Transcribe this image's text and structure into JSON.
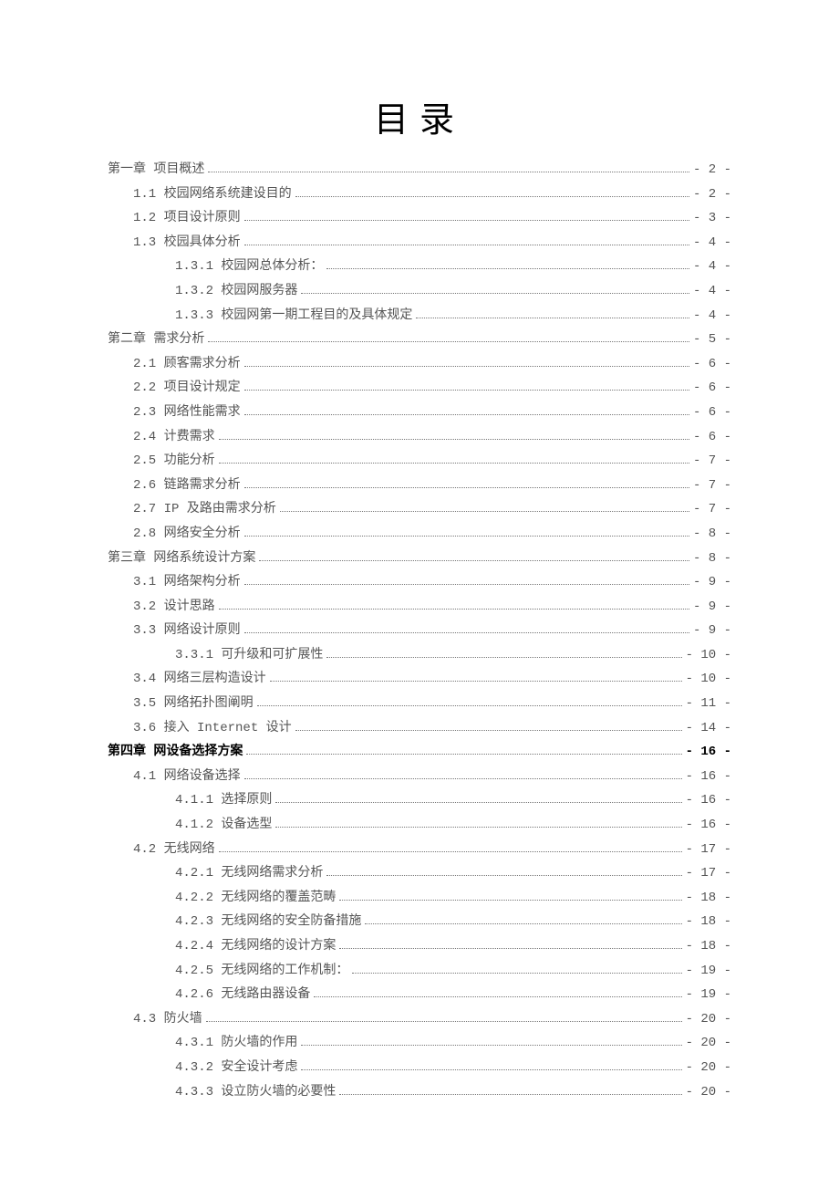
{
  "title": "目录",
  "toc": [
    {
      "level": 0,
      "text": "第一章 项目概述",
      "page": "- 2 -"
    },
    {
      "level": 1,
      "text": "1.1 校园网络系统建设目的",
      "page": "- 2 -"
    },
    {
      "level": 1,
      "text": "1.2 项目设计原则",
      "page": "- 3 -"
    },
    {
      "level": 1,
      "text": "1.3 校园具体分析",
      "page": "- 4 -"
    },
    {
      "level": 2,
      "text": "1.3.1 校园网总体分析：",
      "page": "- 4 -"
    },
    {
      "level": 2,
      "text": "1.3.2 校园网服务器",
      "page": "- 4 -"
    },
    {
      "level": 2,
      "text": "1.3.3 校园网第一期工程目的及具体规定",
      "page": "- 4 -"
    },
    {
      "level": 0,
      "text": "第二章 需求分析",
      "page": "- 5 -"
    },
    {
      "level": 1,
      "text": "2.1 顾客需求分析",
      "page": "- 6 -"
    },
    {
      "level": 1,
      "text": "2.2 项目设计规定",
      "page": "- 6 -"
    },
    {
      "level": 1,
      "text": "2.3 网络性能需求",
      "page": "- 6 -"
    },
    {
      "level": 1,
      "text": "2.4 计费需求",
      "page": "- 6 -"
    },
    {
      "level": 1,
      "text": "2.5 功能分析",
      "page": "- 7 -"
    },
    {
      "level": 1,
      "text": "2.6 链路需求分析",
      "page": "- 7 -"
    },
    {
      "level": 1,
      "text": "2.7 IP 及路由需求分析",
      "page": "- 7 -"
    },
    {
      "level": 1,
      "text": "2.8 网络安全分析",
      "page": "- 8 -"
    },
    {
      "level": 0,
      "text": "第三章 网络系统设计方案",
      "page": "- 8 -"
    },
    {
      "level": 1,
      "text": "3.1 网络架构分析",
      "page": "- 9 -"
    },
    {
      "level": 1,
      "text": "3.2 设计思路",
      "page": "- 9 -"
    },
    {
      "level": 1,
      "text": "3.3 网络设计原则",
      "page": "- 9 -"
    },
    {
      "level": 2,
      "text": "3.3.1 可升级和可扩展性",
      "page": "- 10 -"
    },
    {
      "level": 1,
      "text": "3.4 网络三层构造设计",
      "page": "- 10 -"
    },
    {
      "level": 1,
      "text": "3.5 网络拓扑图阐明",
      "page": "- 11 -"
    },
    {
      "level": 1,
      "text": "3.6 接入 Internet 设计",
      "page": "- 14 -"
    },
    {
      "level": 0,
      "text": "第四章 网设备选择方案",
      "page": "- 16 -",
      "bold": true
    },
    {
      "level": 1,
      "text": "4.1 网络设备选择",
      "page": "- 16 -"
    },
    {
      "level": 2,
      "text": "4.1.1 选择原则",
      "page": "- 16 -"
    },
    {
      "level": 2,
      "text": "4.1.2 设备选型",
      "page": "- 16 -"
    },
    {
      "level": 1,
      "text": "4.2 无线网络",
      "page": "- 17 -"
    },
    {
      "level": 2,
      "text": "4.2.1 无线网络需求分析",
      "page": "- 17 -"
    },
    {
      "level": 2,
      "text": "4.2.2 无线网络的覆盖范畴",
      "page": "- 18 -"
    },
    {
      "level": 2,
      "text": "4.2.3 无线网络的安全防备措施",
      "page": "- 18 -"
    },
    {
      "level": 2,
      "text": "4.2.4 无线网络的设计方案",
      "page": "- 18 -"
    },
    {
      "level": 2,
      "text": "4.2.5 无线网络的工作机制：",
      "page": "- 19 -"
    },
    {
      "level": 2,
      "text": "4.2.6 无线路由器设备",
      "page": "- 19 -"
    },
    {
      "level": 1,
      "text": "4.3 防火墙",
      "page": "- 20 -"
    },
    {
      "level": 2,
      "text": "4.3.1 防火墙的作用",
      "page": "- 20 -"
    },
    {
      "level": 2,
      "text": "4.3.2 安全设计考虑",
      "page": "- 20 -"
    },
    {
      "level": 2,
      "text": "4.3.3 设立防火墙的必要性",
      "page": "- 20 -"
    }
  ]
}
